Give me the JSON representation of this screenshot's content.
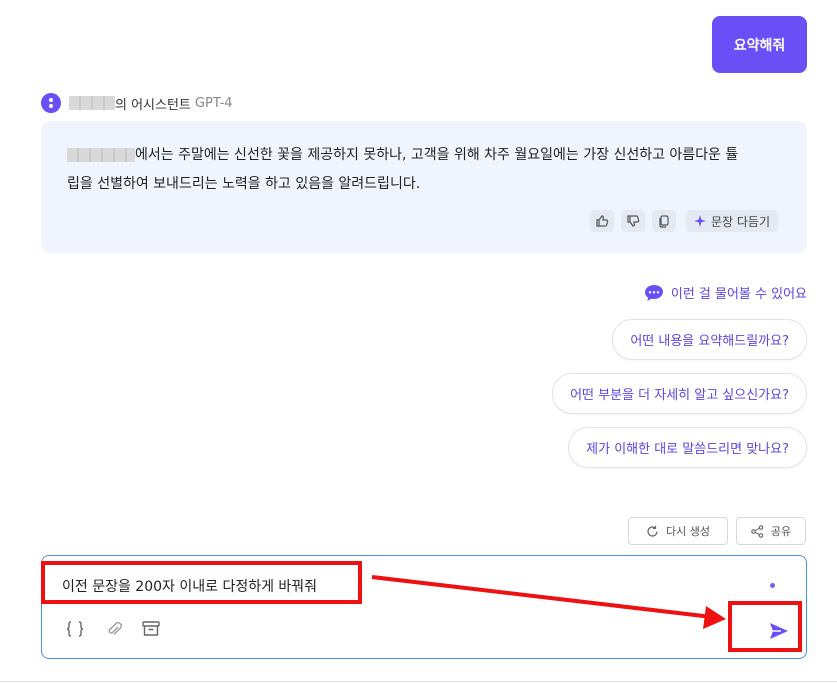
{
  "user_message": {
    "text": "요약해줘"
  },
  "assistant": {
    "name_suffix": "의 어시스턴트",
    "model": "GPT-4",
    "answer_line1": "에서는 주말에는 신선한 꽃을 제공하지 못하나, 고객을 위해 차주 월요일에는 가장 신선하고 아름다운 튤",
    "answer_line2": "립을 선별하여 보내드리는 노력을 하고 있음을 알려드립니다.",
    "actions": {
      "like_icon": "thumbs-up-icon",
      "dislike_icon": "thumbs-down-icon",
      "copy_icon": "copy-icon",
      "polish_label": "문장 다듬기"
    }
  },
  "suggestions": {
    "title": "이런 걸 물어볼 수 있어요",
    "items": [
      "어떤 내용을 요약해드릴까요?",
      "어떤 부분을 더 자세히 알고 싶으신가요?",
      "제가 이해한 대로 말씀드리면 맞나요?"
    ]
  },
  "controls": {
    "regenerate_label": "다시 생성",
    "share_label": "공유"
  },
  "composer": {
    "input_text": "이전 문장을 200자 이내로 다정하게 바꿔줘",
    "tools": [
      "code-braces-icon",
      "paperclip-icon",
      "archive-icon"
    ],
    "send_icon": "send-icon"
  },
  "colors": {
    "accent": "#6b4ff6",
    "highlight": "#ee1111",
    "card_bg": "#f0f4fc"
  }
}
